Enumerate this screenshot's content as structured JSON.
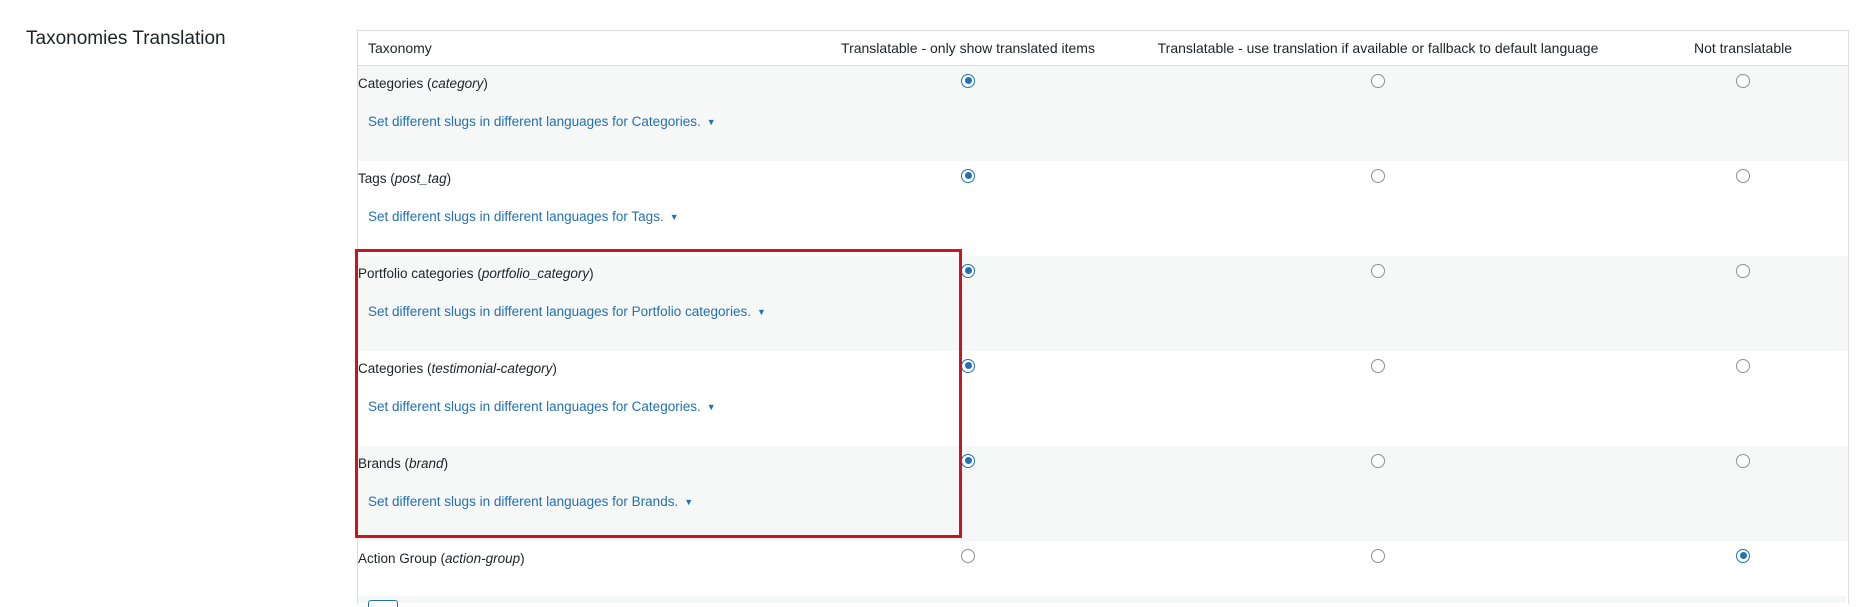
{
  "section": {
    "title": "Taxonomies Translation"
  },
  "table": {
    "headers": {
      "taxonomy": "Taxonomy",
      "translated_only": "Translatable - only show translated items",
      "fallback": "Translatable - use translation if available or fallback to default language",
      "not_translatable": "Not translatable"
    },
    "rows": [
      {
        "name": "Categories",
        "slug": "category",
        "selected": "translated_only",
        "slug_link": "Set different slugs in different languages for Categories.",
        "caret": "▼"
      },
      {
        "name": "Tags",
        "slug": "post_tag",
        "selected": "translated_only",
        "slug_link": "Set different slugs in different languages for Tags.",
        "caret": "▼"
      },
      {
        "name": "Portfolio categories",
        "slug": "portfolio_category",
        "selected": "translated_only",
        "slug_link": "Set different slugs in different languages for Portfolio categories.",
        "caret": "▼"
      },
      {
        "name": "Categories",
        "slug": "testimonial-category",
        "selected": "translated_only",
        "slug_link": "Set different slugs in different languages for Categories.",
        "caret": "▼"
      },
      {
        "name": "Brands",
        "slug": "brand",
        "selected": "translated_only",
        "slug_link": "Set different slugs in different languages for Brands.",
        "caret": "▼"
      },
      {
        "name": "Action Group",
        "slug": "action-group",
        "selected": "not_translatable"
      }
    ]
  },
  "colors": {
    "link": "#2271b1",
    "radio_checked": "#2271b1",
    "highlight": "#c8161d",
    "row_shade": "#f6f7f7"
  }
}
